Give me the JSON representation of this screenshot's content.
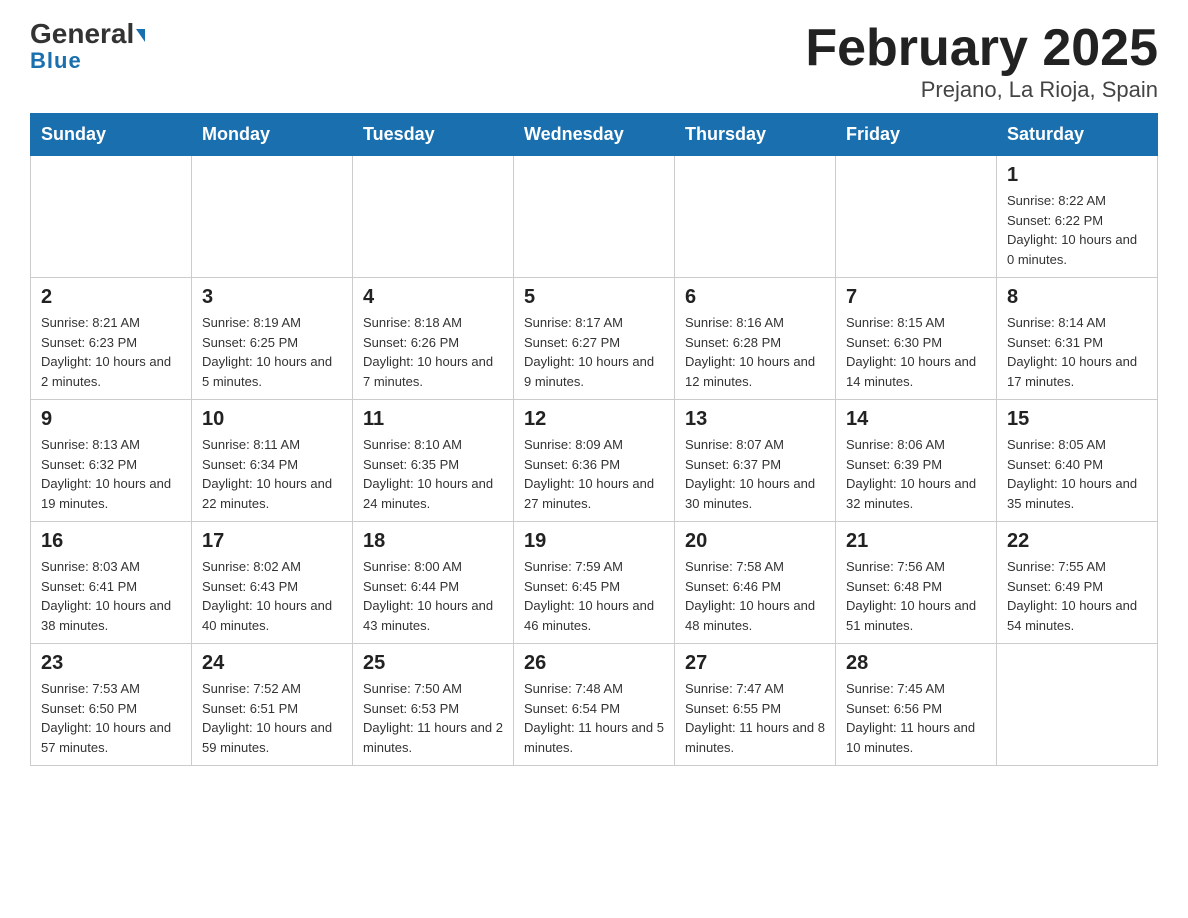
{
  "logo": {
    "general": "General",
    "blue": "Blue"
  },
  "title": "February 2025",
  "subtitle": "Prejano, La Rioja, Spain",
  "days_of_week": [
    "Sunday",
    "Monday",
    "Tuesday",
    "Wednesday",
    "Thursday",
    "Friday",
    "Saturday"
  ],
  "weeks": [
    [
      {
        "day": "",
        "info": ""
      },
      {
        "day": "",
        "info": ""
      },
      {
        "day": "",
        "info": ""
      },
      {
        "day": "",
        "info": ""
      },
      {
        "day": "",
        "info": ""
      },
      {
        "day": "",
        "info": ""
      },
      {
        "day": "1",
        "info": "Sunrise: 8:22 AM\nSunset: 6:22 PM\nDaylight: 10 hours and 0 minutes."
      }
    ],
    [
      {
        "day": "2",
        "info": "Sunrise: 8:21 AM\nSunset: 6:23 PM\nDaylight: 10 hours and 2 minutes."
      },
      {
        "day": "3",
        "info": "Sunrise: 8:19 AM\nSunset: 6:25 PM\nDaylight: 10 hours and 5 minutes."
      },
      {
        "day": "4",
        "info": "Sunrise: 8:18 AM\nSunset: 6:26 PM\nDaylight: 10 hours and 7 minutes."
      },
      {
        "day": "5",
        "info": "Sunrise: 8:17 AM\nSunset: 6:27 PM\nDaylight: 10 hours and 9 minutes."
      },
      {
        "day": "6",
        "info": "Sunrise: 8:16 AM\nSunset: 6:28 PM\nDaylight: 10 hours and 12 minutes."
      },
      {
        "day": "7",
        "info": "Sunrise: 8:15 AM\nSunset: 6:30 PM\nDaylight: 10 hours and 14 minutes."
      },
      {
        "day": "8",
        "info": "Sunrise: 8:14 AM\nSunset: 6:31 PM\nDaylight: 10 hours and 17 minutes."
      }
    ],
    [
      {
        "day": "9",
        "info": "Sunrise: 8:13 AM\nSunset: 6:32 PM\nDaylight: 10 hours and 19 minutes."
      },
      {
        "day": "10",
        "info": "Sunrise: 8:11 AM\nSunset: 6:34 PM\nDaylight: 10 hours and 22 minutes."
      },
      {
        "day": "11",
        "info": "Sunrise: 8:10 AM\nSunset: 6:35 PM\nDaylight: 10 hours and 24 minutes."
      },
      {
        "day": "12",
        "info": "Sunrise: 8:09 AM\nSunset: 6:36 PM\nDaylight: 10 hours and 27 minutes."
      },
      {
        "day": "13",
        "info": "Sunrise: 8:07 AM\nSunset: 6:37 PM\nDaylight: 10 hours and 30 minutes."
      },
      {
        "day": "14",
        "info": "Sunrise: 8:06 AM\nSunset: 6:39 PM\nDaylight: 10 hours and 32 minutes."
      },
      {
        "day": "15",
        "info": "Sunrise: 8:05 AM\nSunset: 6:40 PM\nDaylight: 10 hours and 35 minutes."
      }
    ],
    [
      {
        "day": "16",
        "info": "Sunrise: 8:03 AM\nSunset: 6:41 PM\nDaylight: 10 hours and 38 minutes."
      },
      {
        "day": "17",
        "info": "Sunrise: 8:02 AM\nSunset: 6:43 PM\nDaylight: 10 hours and 40 minutes."
      },
      {
        "day": "18",
        "info": "Sunrise: 8:00 AM\nSunset: 6:44 PM\nDaylight: 10 hours and 43 minutes."
      },
      {
        "day": "19",
        "info": "Sunrise: 7:59 AM\nSunset: 6:45 PM\nDaylight: 10 hours and 46 minutes."
      },
      {
        "day": "20",
        "info": "Sunrise: 7:58 AM\nSunset: 6:46 PM\nDaylight: 10 hours and 48 minutes."
      },
      {
        "day": "21",
        "info": "Sunrise: 7:56 AM\nSunset: 6:48 PM\nDaylight: 10 hours and 51 minutes."
      },
      {
        "day": "22",
        "info": "Sunrise: 7:55 AM\nSunset: 6:49 PM\nDaylight: 10 hours and 54 minutes."
      }
    ],
    [
      {
        "day": "23",
        "info": "Sunrise: 7:53 AM\nSunset: 6:50 PM\nDaylight: 10 hours and 57 minutes."
      },
      {
        "day": "24",
        "info": "Sunrise: 7:52 AM\nSunset: 6:51 PM\nDaylight: 10 hours and 59 minutes."
      },
      {
        "day": "25",
        "info": "Sunrise: 7:50 AM\nSunset: 6:53 PM\nDaylight: 11 hours and 2 minutes."
      },
      {
        "day": "26",
        "info": "Sunrise: 7:48 AM\nSunset: 6:54 PM\nDaylight: 11 hours and 5 minutes."
      },
      {
        "day": "27",
        "info": "Sunrise: 7:47 AM\nSunset: 6:55 PM\nDaylight: 11 hours and 8 minutes."
      },
      {
        "day": "28",
        "info": "Sunrise: 7:45 AM\nSunset: 6:56 PM\nDaylight: 11 hours and 10 minutes."
      },
      {
        "day": "",
        "info": ""
      }
    ]
  ]
}
